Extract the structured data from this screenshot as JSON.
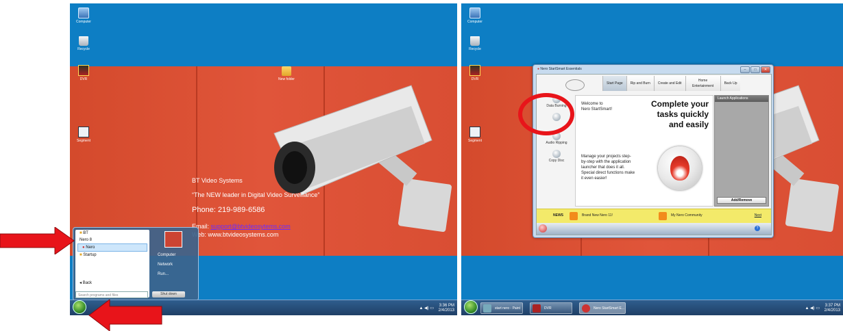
{
  "left_screen": {
    "desktop_icons": [
      {
        "label": "Computer",
        "icon": "computer-icon"
      },
      {
        "label": "Recycle",
        "icon": "recycle-bin-icon"
      },
      {
        "label": "DVR",
        "icon": "dvr-icon"
      },
      {
        "label": "Segment",
        "icon": "segment-icon"
      },
      {
        "label": "New folder",
        "icon": "folder-icon"
      }
    ],
    "wallpaper": {
      "company": "BT Video Systems",
      "tagline": "“The NEW leader in Digital Video Surveillance”",
      "phone": "Phone:  219-989-6586",
      "email_label": "Email: ",
      "email": "support@btvideosytems.com",
      "web": "Web: www.btvideosystems.com"
    },
    "start_menu": {
      "items": [
        "BT",
        "Nero 8",
        "Nero",
        "Startup"
      ],
      "back": "Back",
      "search_placeholder": "Search programs and files",
      "right_items": [
        "Computer",
        "Network",
        "Run..."
      ],
      "shutdown": "Shut down"
    },
    "clock": {
      "time": "3:36 PM",
      "date": "2/4/2013"
    }
  },
  "right_screen": {
    "desktop_icons": [
      {
        "label": "Computer"
      },
      {
        "label": "Recycle"
      },
      {
        "label": "DVR"
      },
      {
        "label": "Segment"
      }
    ],
    "nero": {
      "title": "Nero StartSmart Essentials",
      "tabs": [
        "Start Page",
        "Rip and Burn",
        "Create and Edit",
        "Home Entertainment",
        "Back Up"
      ],
      "sidebar": [
        "Data Burning",
        "Audio Ripping",
        "Copy Disc"
      ],
      "welcome_line1": "Welcome to",
      "welcome_line2": "Nero StartSmart!",
      "headline": [
        "Complete your",
        "tasks quickly",
        "and easily"
      ],
      "blurb": "Manage your projects step-by-step with the application launcher that does it all. Special direct functions make it even easier!",
      "launch_header": "Launch Applications",
      "add_remove": "Add/Remove",
      "news_label": "NEWS",
      "news_items": [
        "Brand New Nero 11!",
        "My Nero Community"
      ],
      "next": "Next"
    },
    "taskbar": [
      {
        "label": "start nero - Paint"
      },
      {
        "label": "DVR"
      },
      {
        "label": "Nero StartSmart E..."
      }
    ],
    "clock": {
      "time": "3:37 PM",
      "date": "2/4/2013"
    }
  },
  "colors": {
    "desktop": "#0d7ec4",
    "wall": "#e0553a",
    "annotation": "#e8141a",
    "news": "#f3ea6a"
  }
}
